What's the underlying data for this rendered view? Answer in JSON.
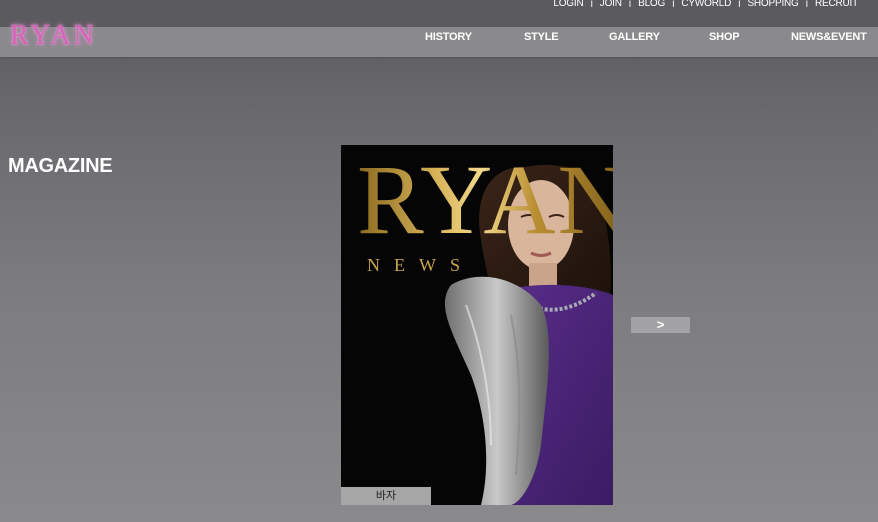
{
  "util_nav": {
    "items": [
      "LOGIN",
      "JOIN",
      "BLOG",
      "CYWORLD",
      "SHOPPING",
      "RECRUIT"
    ],
    "separator": "I"
  },
  "brand": {
    "logo_text": "RYAN",
    "logo_color": "#d763b9"
  },
  "main_nav": {
    "items": [
      "HISTORY",
      "STYLE",
      "GALLERY",
      "SHOP",
      "NEWS&EVENT"
    ]
  },
  "page": {
    "heading": "MAGAZINE"
  },
  "magazine": {
    "cover_title": "RYAN",
    "cover_subtitle": "NEWS",
    "caption": "바자",
    "next_label": ">"
  }
}
